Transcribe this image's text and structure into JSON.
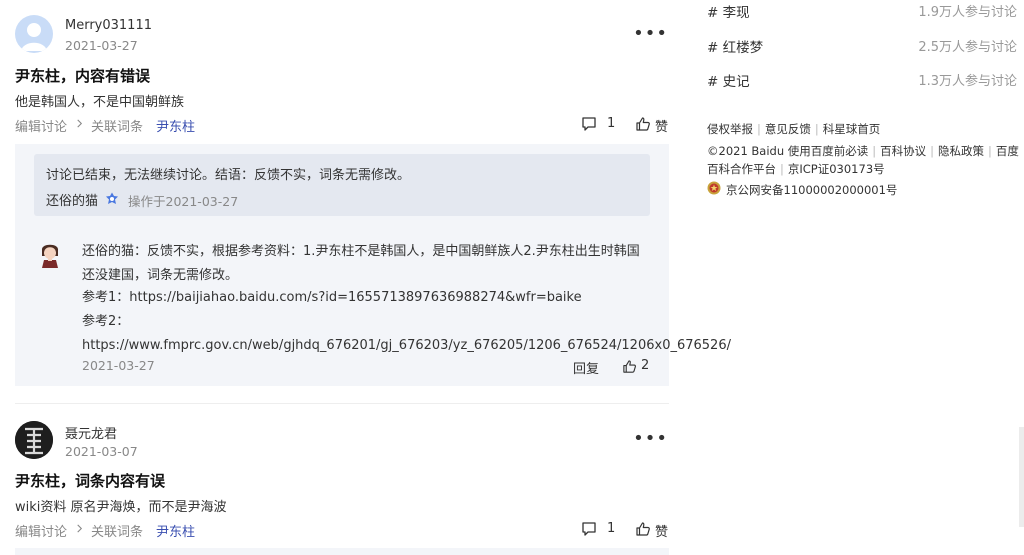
{
  "posts": [
    {
      "username": "Merry031111",
      "date": "2021-03-27",
      "more": "•••",
      "title": "尹东柱，内容有错误",
      "content": "他是韩国人，不是中国朝鲜族",
      "edit_label": "编辑讨论",
      "related_label": "关联词条",
      "entry": "尹东柱",
      "comment_count": "1",
      "like_label": "赞"
    },
    {
      "username": "聂元龙君",
      "date": "2021-03-07",
      "more": "•••",
      "title": "尹东柱，词条内容有误",
      "content": "wiki资料 原名尹海焕，而不是尹海波",
      "edit_label": "编辑讨论",
      "related_label": "关联词条",
      "entry": "尹东柱",
      "comment_count": "1",
      "like_label": "赞"
    }
  ],
  "notice": {
    "text": "讨论已结束，无法继续讨论。结语：反馈不实，词条无需修改。",
    "operator": "还俗的猫",
    "op_time": "操作于2021-03-27"
  },
  "reply": {
    "text": "还俗的猫：反馈不实，根据参考资料：1.尹东柱不是韩国人，是中国朝鲜族人2.尹东柱出生时韩国还没建国，词条无需修改。",
    "ref1": "参考1：https://baijiahao.baidu.com/s?id=1655713897636988274&wfr=baike",
    "ref2": "参考2：https://www.fmprc.gov.cn/web/gjhdq_676201/gj_676203/yz_676205/1206_676524/1206x0_676526/",
    "date": "2021-03-27",
    "reply_label": "回复",
    "like_count": "2"
  },
  "topics": [
    {
      "name": "# 李现",
      "count": "1.9万人参与讨论"
    },
    {
      "name": "# 红楼梦",
      "count": "2.5万人参与讨论"
    },
    {
      "name": "# 史记",
      "count": "1.3万人参与讨论"
    }
  ],
  "footer": {
    "row1": [
      "侵权举报",
      "意见反馈",
      "科星球首页"
    ],
    "row2": [
      "©2021 Baidu 使用百度前必读",
      "百科协议",
      "隐私政策",
      "百度"
    ],
    "row3": [
      "百科合作平台",
      "京ICP证030173号"
    ],
    "police": "京公网安备11000002000001号"
  },
  "colors": {
    "link_blue": "#3a4fb0",
    "discussion_bg": "#f3f5f9",
    "notice_bg": "#e4e8f0",
    "muted": "#888888"
  }
}
